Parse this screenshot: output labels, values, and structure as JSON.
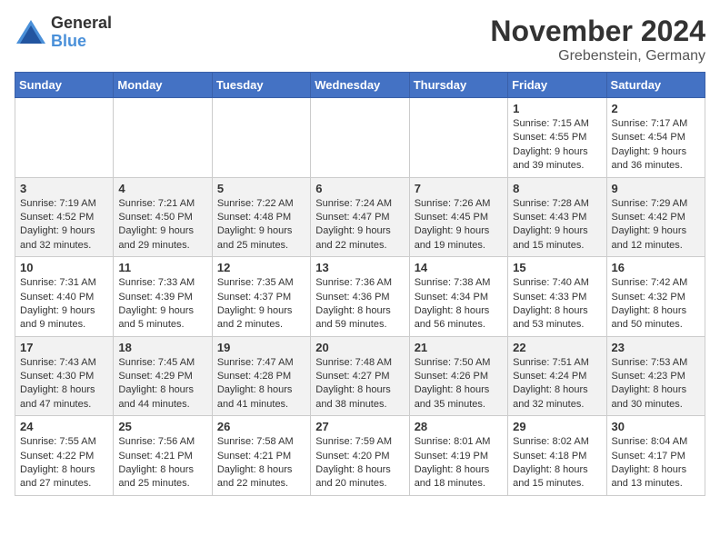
{
  "logo": {
    "general": "General",
    "blue": "Blue"
  },
  "title": "November 2024",
  "location": "Grebenstein, Germany",
  "days_of_week": [
    "Sunday",
    "Monday",
    "Tuesday",
    "Wednesday",
    "Thursday",
    "Friday",
    "Saturday"
  ],
  "weeks": [
    [
      {
        "day": "",
        "info": ""
      },
      {
        "day": "",
        "info": ""
      },
      {
        "day": "",
        "info": ""
      },
      {
        "day": "",
        "info": ""
      },
      {
        "day": "",
        "info": ""
      },
      {
        "day": "1",
        "info": "Sunrise: 7:15 AM\nSunset: 4:55 PM\nDaylight: 9 hours\nand 39 minutes."
      },
      {
        "day": "2",
        "info": "Sunrise: 7:17 AM\nSunset: 4:54 PM\nDaylight: 9 hours\nand 36 minutes."
      }
    ],
    [
      {
        "day": "3",
        "info": "Sunrise: 7:19 AM\nSunset: 4:52 PM\nDaylight: 9 hours\nand 32 minutes."
      },
      {
        "day": "4",
        "info": "Sunrise: 7:21 AM\nSunset: 4:50 PM\nDaylight: 9 hours\nand 29 minutes."
      },
      {
        "day": "5",
        "info": "Sunrise: 7:22 AM\nSunset: 4:48 PM\nDaylight: 9 hours\nand 25 minutes."
      },
      {
        "day": "6",
        "info": "Sunrise: 7:24 AM\nSunset: 4:47 PM\nDaylight: 9 hours\nand 22 minutes."
      },
      {
        "day": "7",
        "info": "Sunrise: 7:26 AM\nSunset: 4:45 PM\nDaylight: 9 hours\nand 19 minutes."
      },
      {
        "day": "8",
        "info": "Sunrise: 7:28 AM\nSunset: 4:43 PM\nDaylight: 9 hours\nand 15 minutes."
      },
      {
        "day": "9",
        "info": "Sunrise: 7:29 AM\nSunset: 4:42 PM\nDaylight: 9 hours\nand 12 minutes."
      }
    ],
    [
      {
        "day": "10",
        "info": "Sunrise: 7:31 AM\nSunset: 4:40 PM\nDaylight: 9 hours\nand 9 minutes."
      },
      {
        "day": "11",
        "info": "Sunrise: 7:33 AM\nSunset: 4:39 PM\nDaylight: 9 hours\nand 5 minutes."
      },
      {
        "day": "12",
        "info": "Sunrise: 7:35 AM\nSunset: 4:37 PM\nDaylight: 9 hours\nand 2 minutes."
      },
      {
        "day": "13",
        "info": "Sunrise: 7:36 AM\nSunset: 4:36 PM\nDaylight: 8 hours\nand 59 minutes."
      },
      {
        "day": "14",
        "info": "Sunrise: 7:38 AM\nSunset: 4:34 PM\nDaylight: 8 hours\nand 56 minutes."
      },
      {
        "day": "15",
        "info": "Sunrise: 7:40 AM\nSunset: 4:33 PM\nDaylight: 8 hours\nand 53 minutes."
      },
      {
        "day": "16",
        "info": "Sunrise: 7:42 AM\nSunset: 4:32 PM\nDaylight: 8 hours\nand 50 minutes."
      }
    ],
    [
      {
        "day": "17",
        "info": "Sunrise: 7:43 AM\nSunset: 4:30 PM\nDaylight: 8 hours\nand 47 minutes."
      },
      {
        "day": "18",
        "info": "Sunrise: 7:45 AM\nSunset: 4:29 PM\nDaylight: 8 hours\nand 44 minutes."
      },
      {
        "day": "19",
        "info": "Sunrise: 7:47 AM\nSunset: 4:28 PM\nDaylight: 8 hours\nand 41 minutes."
      },
      {
        "day": "20",
        "info": "Sunrise: 7:48 AM\nSunset: 4:27 PM\nDaylight: 8 hours\nand 38 minutes."
      },
      {
        "day": "21",
        "info": "Sunrise: 7:50 AM\nSunset: 4:26 PM\nDaylight: 8 hours\nand 35 minutes."
      },
      {
        "day": "22",
        "info": "Sunrise: 7:51 AM\nSunset: 4:24 PM\nDaylight: 8 hours\nand 32 minutes."
      },
      {
        "day": "23",
        "info": "Sunrise: 7:53 AM\nSunset: 4:23 PM\nDaylight: 8 hours\nand 30 minutes."
      }
    ],
    [
      {
        "day": "24",
        "info": "Sunrise: 7:55 AM\nSunset: 4:22 PM\nDaylight: 8 hours\nand 27 minutes."
      },
      {
        "day": "25",
        "info": "Sunrise: 7:56 AM\nSunset: 4:21 PM\nDaylight: 8 hours\nand 25 minutes."
      },
      {
        "day": "26",
        "info": "Sunrise: 7:58 AM\nSunset: 4:21 PM\nDaylight: 8 hours\nand 22 minutes."
      },
      {
        "day": "27",
        "info": "Sunrise: 7:59 AM\nSunset: 4:20 PM\nDaylight: 8 hours\nand 20 minutes."
      },
      {
        "day": "28",
        "info": "Sunrise: 8:01 AM\nSunset: 4:19 PM\nDaylight: 8 hours\nand 18 minutes."
      },
      {
        "day": "29",
        "info": "Sunrise: 8:02 AM\nSunset: 4:18 PM\nDaylight: 8 hours\nand 15 minutes."
      },
      {
        "day": "30",
        "info": "Sunrise: 8:04 AM\nSunset: 4:17 PM\nDaylight: 8 hours\nand 13 minutes."
      }
    ]
  ]
}
